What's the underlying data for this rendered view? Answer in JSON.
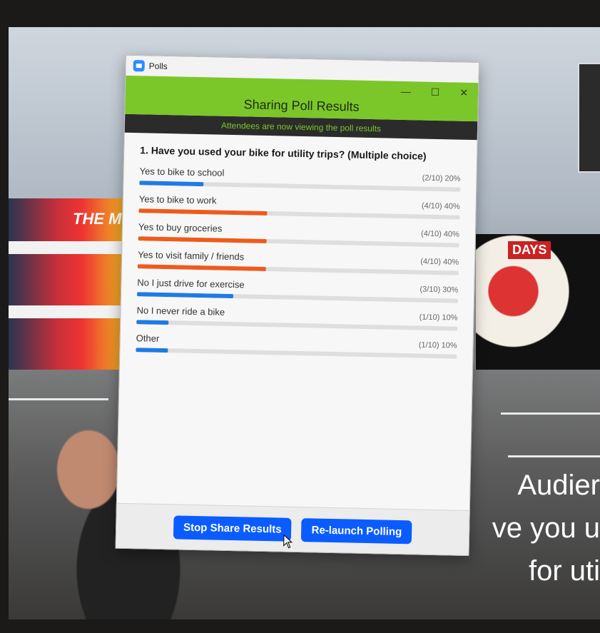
{
  "window": {
    "app_title": "Polls",
    "header_title": "Sharing Poll Results",
    "subheader": "Attendees are now viewing the poll results",
    "controls": {
      "minimize": "—",
      "maximize": "☐",
      "close": "✕"
    }
  },
  "question": "1. Have you used your bike for utility trips? (Multiple choice)",
  "options": [
    {
      "label": "Yes to bike to school",
      "value": "(2/10) 20%",
      "fraction": 0.2,
      "color": "#1e7be6"
    },
    {
      "label": "Yes to bike to work",
      "value": "(4/10) 40%",
      "fraction": 0.4,
      "color": "#f05a1a"
    },
    {
      "label": "Yes to buy groceries",
      "value": "(4/10) 40%",
      "fraction": 0.4,
      "color": "#f05a1a"
    },
    {
      "label": "Yes to visit family / friends",
      "value": "(4/10) 40%",
      "fraction": 0.4,
      "color": "#f05a1a"
    },
    {
      "label": "No I just drive for exercise",
      "value": "(3/10) 30%",
      "fraction": 0.3,
      "color": "#1e7be6"
    },
    {
      "label": "No I never ride a bike",
      "value": "(1/10) 10%",
      "fraction": 0.1,
      "color": "#1e7be6"
    },
    {
      "label": "Other",
      "value": "(1/10) 10%",
      "fraction": 0.1,
      "color": "#1e7be6"
    }
  ],
  "buttons": {
    "stop_share": "Stop Share Results",
    "relaunch": "Re-launch Polling"
  },
  "background": {
    "mural_text": "THE MO",
    "days_sign": "DAYS",
    "side_lines": [
      "Audier",
      "ve you u",
      "for uti"
    ]
  }
}
